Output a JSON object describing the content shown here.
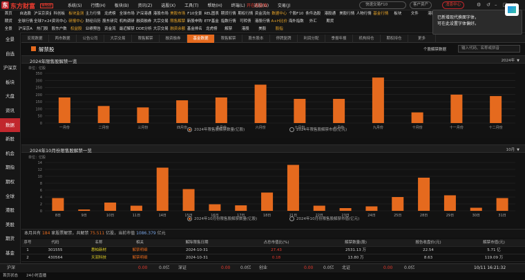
{
  "app": {
    "name": "东方财富",
    "edition": "策略版",
    "live": "开在线咨询"
  },
  "menu": [
    "系统(S)",
    "行情(H)",
    "板块(B)",
    "资讯(Z)",
    "选股(X)",
    "工具(T)",
    "帮助(H)",
    "终端(L)",
    "选股(G)",
    "交易(J)",
    "帮助(Y)"
  ],
  "top_right": {
    "search": "快速交易F10",
    "btn1": "客户资产",
    "btn2": "消息中心"
  },
  "quick_rows": [
    [
      "首页",
      "自选股",
      "沪深京资金",
      "科创板",
      "板块监测",
      "主力行情",
      "龙虎榜",
      "全球市场",
      "沪深港通",
      "港股市场",
      "美股市场",
      "F10全景",
      "REL图表",
      "期货行情",
      "期权行情",
      "资金流向",
      "数据中心",
      "个股F10",
      "条件选股",
      "港股通",
      "美股行情",
      "人物行情",
      "基金行情",
      "板块",
      "文件",
      "港股"
    ],
    [
      "期货",
      "全球行情",
      "全球7×24",
      "资讯中心",
      "研报中心",
      "财经日历",
      "股东研究",
      "机构调研",
      "融资融券",
      "大宗交易",
      "限售解禁",
      "新股申购",
      "ETF基金",
      "指数行情",
      "可转债",
      "港股行情",
      "A+H比价",
      "海外指数",
      "外汇",
      "期货"
    ],
    [
      "全景",
      "沪深京A",
      "热门股",
      "股东户数",
      "权益股",
      "业绩预告",
      "资金流",
      "最近解禁",
      "DDE分析",
      "大宗交易",
      "融资余额",
      "基金排名",
      "龙虎榜",
      "解禁",
      "港股",
      "美股",
      "股指"
    ]
  ],
  "left_nav": [
    "全景",
    "自选",
    "沪深京",
    "板块",
    "大盘",
    "资讯",
    "数据",
    "新股",
    "机会",
    "期指",
    "期权",
    "全球",
    "港股",
    "美股",
    "期货",
    "基金",
    "REITs",
    "债券",
    "外汇",
    "交易"
  ],
  "sub_tabs": [
    "宏观数据",
    "两市数据",
    "公告公司",
    "大宗交易",
    "限售解禁",
    "融资融券",
    "基金数据",
    "限售解禁",
    "股东股本",
    "停牌复牌",
    "利润分配",
    "季报年报",
    "机构持仓",
    "期权持仓",
    "更多"
  ],
  "sub_tab_active": 6,
  "page": {
    "title": "解禁股",
    "link": "个股解禁数据",
    "search_placeholder": "输入代码、名称或拼音"
  },
  "panel1": {
    "title": "2024年限售股解禁一览",
    "select": "2024年",
    "unit": "单位：亿股",
    "legend_a": "2024年限售股解禁数量(亿股)",
    "legend_b": "2024年限售股解禁市值(亿元)"
  },
  "panel2": {
    "title": "2024年10月份限售股解禁一览",
    "select": "10月",
    "unit": "单位：亿股",
    "legend_a": "2024年10月份限售股解禁数量(亿股)",
    "legend_b": "2024年10月份限售股解禁市值(亿元)"
  },
  "chart_data": [
    {
      "type": "bar",
      "categories": [
        "一月份",
        "二月份",
        "三月份",
        "四月份",
        "五月份",
        "六月份",
        "七月份",
        "八月份",
        "九月份",
        "十月份",
        "十一月份",
        "十二月份"
      ],
      "series": [
        {
          "name": "2024年限售股解禁数量(亿股)",
          "values": [
            180,
            120,
            110,
            160,
            180,
            270,
            170,
            170,
            320,
            75,
            200,
            190
          ]
        }
      ],
      "ylabel": "单位：亿股",
      "ylim": [
        0,
        350
      ],
      "yticks": [
        0,
        50,
        100,
        150,
        200,
        250,
        300,
        350
      ],
      "color": "#e56a1e"
    },
    {
      "type": "bar",
      "categories": [
        "8日",
        "9日",
        "10日",
        "11日",
        "14日",
        "15日",
        "16日",
        "17日",
        "18日",
        "21日",
        "22日",
        "23日",
        "24日",
        "25日",
        "28日",
        "29日",
        "30日",
        "31日"
      ],
      "series": [
        {
          "name": "2024年10月份限售股解禁数量(亿股)",
          "values": [
            3.7,
            0.4,
            2.4,
            1.5,
            12.5,
            6.3,
            1.9,
            1.6,
            5.3,
            13.3,
            1.5,
            0.8,
            1.3,
            4.0,
            9.6,
            4.5,
            0.9,
            3.7
          ]
        }
      ],
      "ylabel": "单位：亿股",
      "ylim": [
        0,
        14
      ],
      "yticks": [
        0,
        2,
        4,
        6,
        8,
        10,
        12,
        14
      ],
      "color": "#e56a1e"
    }
  ],
  "summary": {
    "pre": "本月共有",
    "count": "184",
    "mid1": "家股票解禁，共解禁",
    "shares": "75.511",
    "mid2": "亿股，当前市值",
    "value": "1086.379",
    "post": "亿元"
  },
  "table": {
    "headers": [
      "序号",
      "代码",
      "名称",
      "相关",
      "解除限售日期",
      "占总市值比(%)",
      "解禁数量(股)",
      "报告收盘价(元)",
      "解禁市值(元)"
    ],
    "rows": [
      [
        "1",
        "301555",
        "惠柏新材",
        "解禁明细",
        "2024-10-31",
        "27.43",
        "2531.13 万",
        "22.54",
        "5.71 亿"
      ],
      [
        "2",
        "430564",
        "天润科技",
        "解禁明细",
        "2024-10-31",
        "0.18",
        "13.80 万",
        "8.63",
        "119.09 万"
      ]
    ]
  },
  "status": {
    "a": "沪深",
    "b": "0.00",
    "c": "0.0亿",
    "d": "深证",
    "e": "0.00",
    "f": "0.0亿",
    "g": "创业",
    "h": "0.00",
    "i": "0.0亿",
    "j": "北证",
    "k": "0.00",
    "l": "0.0亿",
    "time": "10/11 16:21:32"
  },
  "bottom": [
    "首页状态",
    "24小时直播"
  ],
  "tooltip": {
    "line1": "已新增现代换面字体，",
    "line2": "可在此设置字体偏好。"
  }
}
